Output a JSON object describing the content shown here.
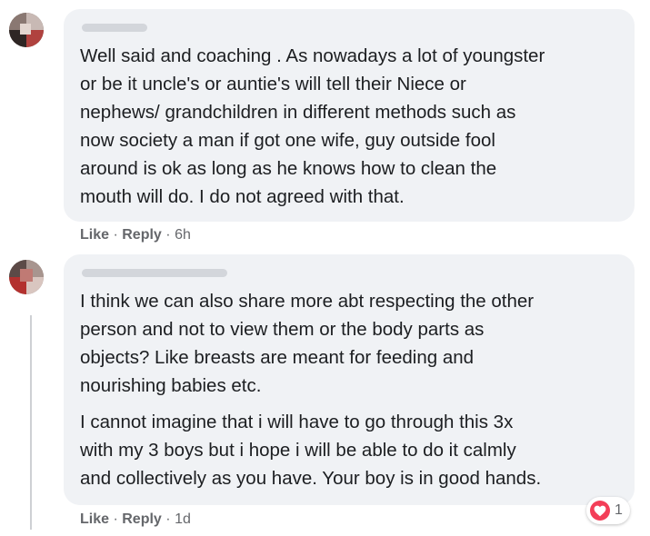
{
  "comments": [
    {
      "paragraphs": [
        "Well said and coaching . As nowadays a lot of youngster\nor be it uncle's or auntie's will tell their Niece or\nnephews/ grandchildren in different methods such as\nnow society a man if got one wife, guy outside fool\naround is ok as long as he knows how to clean the\nmouth will do. I do not agreed with that."
      ],
      "like_label": "Like",
      "reply_label": "Reply",
      "separator": "·",
      "time": "6h"
    },
    {
      "paragraphs": [
        "I think we can also share more abt respecting the other\nperson and not to view them or the body parts as\nobjects? Like breasts are meant for feeding and\nnourishing babies etc.",
        "I cannot imagine that i will have to go through this 3x\nwith my 3 boys but i hope i will be able to do it calmly\nand collectively as you have. Your boy is in good hands."
      ],
      "like_label": "Like",
      "reply_label": "Reply",
      "separator": "·",
      "time": "1d",
      "reaction": {
        "icon": "heart-icon",
        "count": "1",
        "color": "#f33e58"
      }
    }
  ]
}
